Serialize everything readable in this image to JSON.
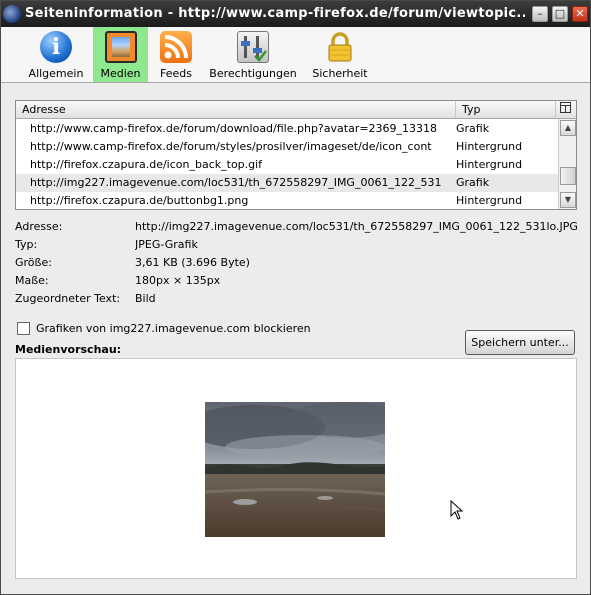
{
  "window": {
    "title": "Seiteninformation - http://www.camp-firefox.de/forum/viewtopic....",
    "controls": {
      "minimize": "–",
      "maximize": "□",
      "close": "✕"
    }
  },
  "toolbar": {
    "tabs": [
      {
        "label": "Allgemein",
        "icon": "info-icon"
      },
      {
        "label": "Medien",
        "icon": "media-icon",
        "selected": true
      },
      {
        "label": "Feeds",
        "icon": "rss-feed-icon"
      },
      {
        "label": "Berechtigungen",
        "icon": "permissions-icon"
      },
      {
        "label": "Sicherheit",
        "icon": "padlock-icon"
      }
    ]
  },
  "media_list": {
    "columns": {
      "address": "Adresse",
      "type": "Typ"
    },
    "rows": [
      {
        "address": "http://www.camp-firefox.de/forum/download/file.php?avatar=2369_13318",
        "type": "Grafik"
      },
      {
        "address": "http://www.camp-firefox.de/forum/styles/prosilver/imageset/de/icon_cont",
        "type": "Hintergrund"
      },
      {
        "address": "http://firefox.czapura.de/icon_back_top.gif",
        "type": "Hintergrund"
      },
      {
        "address": "http://img227.imagevenue.com/loc531/th_672558297_IMG_0061_122_531",
        "type": "Grafik",
        "selected": true
      },
      {
        "address": "http://firefox.czapura.de/buttonbg1.png",
        "type": "Hintergrund"
      }
    ]
  },
  "details": {
    "address_label": "Adresse:",
    "address_value": "http://img227.imagevenue.com/loc531/th_672558297_IMG_0061_122_531lo.JPG",
    "type_label": "Typ:",
    "type_value": "JPEG-Grafik",
    "size_label": "Größe:",
    "size_value": "3,61 KB (3.696 Byte)",
    "dims_label": "Maße:",
    "dims_value": "180px × 135px",
    "alt_label": "Zugeordneter Text:",
    "alt_value": "Bild"
  },
  "block": {
    "label": "Grafiken von img227.imagevenue.com blockieren",
    "checked": false
  },
  "save_button": {
    "label": "Speichern unter..."
  },
  "preview": {
    "label": "Medienvorschau:"
  },
  "colors": {
    "titlebar": "#1b1b1b",
    "selected_tab": "#8ee98e",
    "selected_row": "#e8e8e8"
  }
}
